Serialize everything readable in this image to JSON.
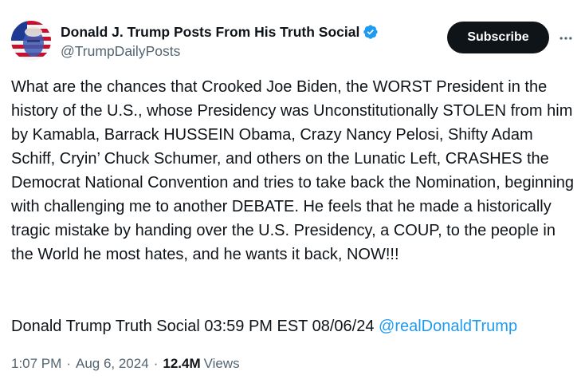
{
  "author": {
    "display_name": "Donald J. Trump Posts From His Truth Social",
    "handle": "@TrumpDailyPosts",
    "verified": true
  },
  "actions": {
    "subscribe_label": "Subscribe",
    "more_icon": "more-horizontal-icon"
  },
  "post": {
    "text": "What are the chances that Crooked Joe Biden, the WORST President in the history of the U.S., whose Presidency was Unconstitutionally STOLEN from him by Kamabla, Barrack HUSSEIN Obama, Crazy Nancy Pelosi, Shifty Adam Schiff, Cryin’ Chuck Schumer, and others on the Lunatic Left, CRASHES the Democrat National Convention and tries to take back the Nomination, beginning with challenging me to another DEBATE. He feels that he made a historically tragic mistake by handing over the U.S. Presidency, a COUP, to the people in the World he most hates, and he wants it back, NOW!!!",
    "source_prefix": "Donald Trump Truth Social 03:59 PM EST 08/06/24",
    "mention": "@realDonaldTrump"
  },
  "meta": {
    "time": "1:07 PM",
    "separator": "·",
    "date": "Aug 6, 2024",
    "views_count": "12.4M",
    "views_label": "Views"
  },
  "colors": {
    "text": "#0f1419",
    "secondary": "#536471",
    "accent": "#1d9bf0",
    "button_bg": "#0f1419"
  }
}
